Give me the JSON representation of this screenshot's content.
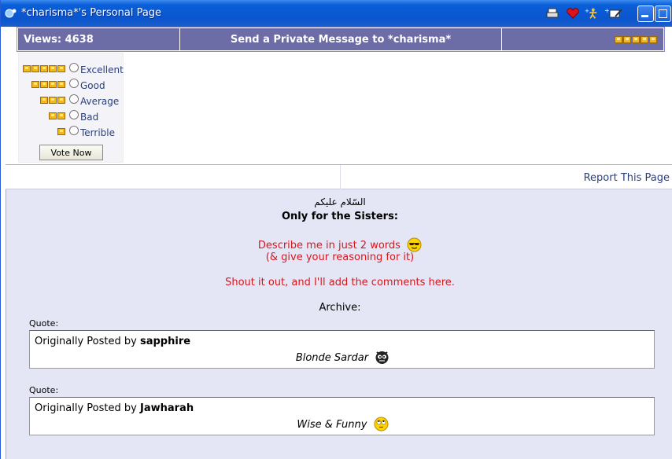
{
  "window": {
    "title": "*charisma*'s Personal Page"
  },
  "header": {
    "views": "Views: 4638",
    "send_pm": "Send a Private Message to *charisma*"
  },
  "rating": {
    "options": [
      {
        "label": "Excellent",
        "stars": 5
      },
      {
        "label": "Good",
        "stars": 4
      },
      {
        "label": "Average",
        "stars": 3
      },
      {
        "label": "Bad",
        "stars": 2
      },
      {
        "label": "Terrible",
        "stars": 1
      }
    ],
    "vote_label": "Vote Now"
  },
  "report": {
    "label": "Report This Page"
  },
  "content": {
    "greeting": "السّلام عليكم",
    "heading": "Only for the Sisters:",
    "line1": "Describe me in just 2 words",
    "line2": "(& give your reasoning for it)",
    "line3": "Shout it out, and I'll add the comments here.",
    "archive": "Archive:",
    "quotes": [
      {
        "label": "Quote:",
        "prefix": "Originally Posted by",
        "author": "sapphire",
        "text": "Blonde Sardar"
      },
      {
        "label": "Quote:",
        "prefix": "Originally Posted by",
        "author": "Jawharah",
        "text": "Wise & Funny"
      }
    ]
  },
  "colors": {
    "title_bar": "#0b55cf",
    "header_bg": "#6c6ca6",
    "content_bg": "#e4e6f5",
    "accent_red": "#d8171d",
    "link": "#2a3f7a"
  }
}
